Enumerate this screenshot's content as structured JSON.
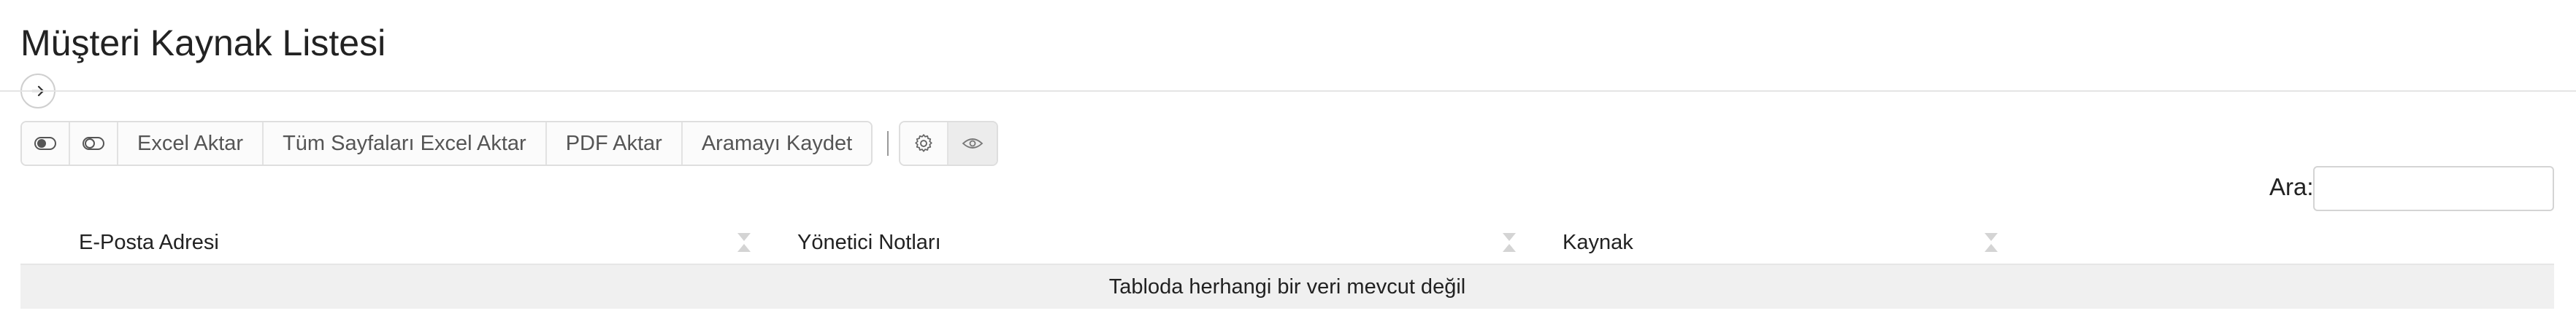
{
  "page": {
    "title": "Müşteri Kaynak Listesi"
  },
  "toolbar": {
    "buttons": [
      {
        "icon": "toggle-on-icon"
      },
      {
        "icon": "toggle-off-icon"
      },
      {
        "label": "Excel Aktar"
      },
      {
        "label": "Tüm Sayfaları Excel Aktar"
      },
      {
        "label": "PDF Aktar"
      },
      {
        "label": "Aramayı Kaydet"
      }
    ],
    "settings_icon": "gear-icon",
    "visibility_icon": "eye-icon"
  },
  "search": {
    "label": "Ara:",
    "value": "",
    "placeholder": ""
  },
  "table": {
    "columns": [
      "E-Posta Adresi",
      "Yönetici Notları",
      "Kaynak",
      ""
    ],
    "rows": [],
    "empty_message": "Tabloda herhangi bir veri mevcut değil"
  }
}
